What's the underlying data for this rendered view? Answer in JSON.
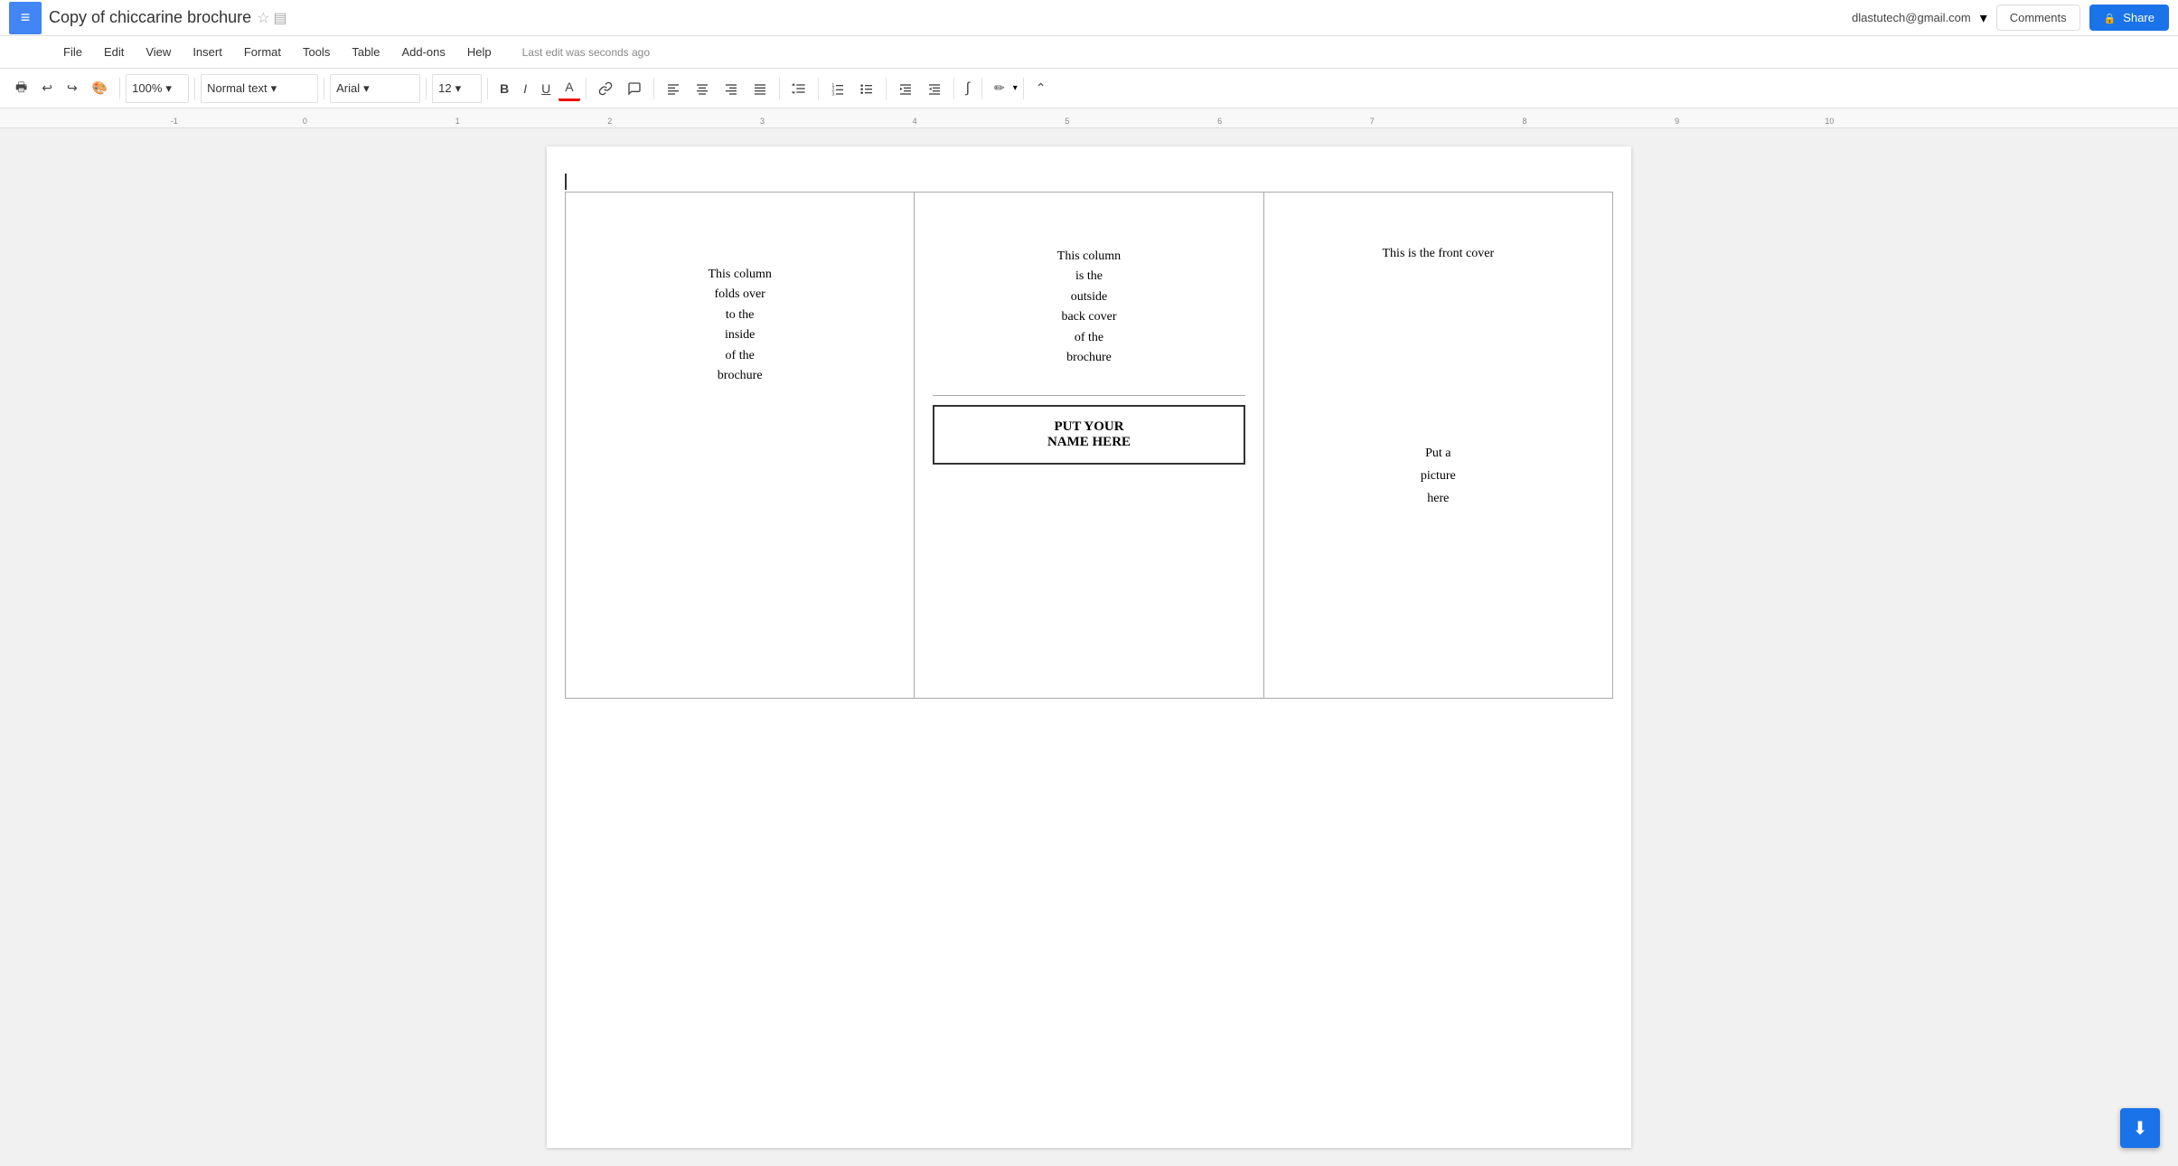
{
  "app": {
    "menu_icon": "≡",
    "title": "Copy of chiccarine brochure",
    "star": "☆",
    "folder": "▤"
  },
  "top_right": {
    "email": "dlastutech@gmail.com",
    "email_chevron": "▾",
    "comments_label": "Comments",
    "share_label": "Share"
  },
  "menu": {
    "items": [
      "File",
      "Edit",
      "View",
      "Insert",
      "Format",
      "Tools",
      "Table",
      "Add-ons",
      "Help"
    ],
    "last_edit": "Last edit was seconds ago"
  },
  "toolbar": {
    "print": "🖶",
    "undo": "↩",
    "redo": "↪",
    "paint": "🎨",
    "zoom": "100%",
    "style": "Normal text",
    "font": "Arial",
    "size": "12",
    "bold": "B",
    "italic": "I",
    "underline": "U",
    "text_color": "A",
    "link": "🔗",
    "comment_tb": "💬",
    "align_left": "≡",
    "align_center": "≡",
    "align_right": "≡",
    "align_justify": "≡",
    "line_spacing": "↕",
    "list_ordered": "1≡",
    "list_unordered": "•≡",
    "indent_decrease": "⇤",
    "indent_increase": "⇥",
    "formula": "∫",
    "pen": "✏",
    "collapse": "⌃"
  },
  "ruler": {
    "marks": [
      "-1",
      "0",
      "1",
      "2",
      "3",
      "4",
      "5",
      "6",
      "7",
      "8",
      "9",
      "10"
    ]
  },
  "document": {
    "col1": {
      "text": "This column\nfolds over\nto the\ninside\nof the\nbrochure"
    },
    "col2": {
      "top_text": "This column\nis the\noutside\nback cover\nof the\nbrochure",
      "name_box": "PUT YOUR\nNAME HERE"
    },
    "col3": {
      "top_text": "This is the front cover",
      "picture_text": "Put a\npicture\nhere"
    }
  },
  "bottom_btn": {
    "icon": "⬇"
  }
}
